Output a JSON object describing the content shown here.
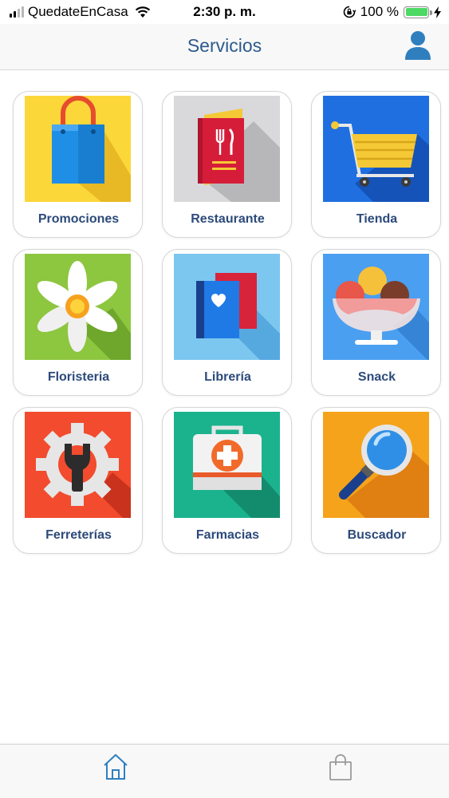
{
  "status_bar": {
    "carrier": "QuedateEnCasa",
    "time": "2:30 p. m.",
    "battery_percent": "100 %",
    "battery_level": 1.0,
    "signal_bars": 2
  },
  "nav": {
    "title": "Servicios",
    "profile_icon": "person-icon"
  },
  "services": [
    {
      "label": "Promociones",
      "icon": "shopping-bag-icon"
    },
    {
      "label": "Restaurante",
      "icon": "menu-book-icon"
    },
    {
      "label": "Tienda",
      "icon": "shopping-cart-icon"
    },
    {
      "label": "Floristeria",
      "icon": "flower-icon"
    },
    {
      "label": "Librería",
      "icon": "books-icon"
    },
    {
      "label": "Snack",
      "icon": "ice-cream-icon"
    },
    {
      "label": "Ferreterías",
      "icon": "wrench-gear-icon"
    },
    {
      "label": "Farmacias",
      "icon": "first-aid-kit-icon"
    },
    {
      "label": "Buscador",
      "icon": "magnifier-icon"
    }
  ],
  "tab_bar": {
    "items": [
      {
        "icon": "home-icon",
        "active": true
      },
      {
        "icon": "shopping-bag-icon",
        "active": false
      }
    ]
  },
  "colors": {
    "accent": "#2c5a8e",
    "label": "#2c4a7a",
    "tab_active": "#2f7fbf",
    "tab_inactive": "#9a9a9a"
  }
}
